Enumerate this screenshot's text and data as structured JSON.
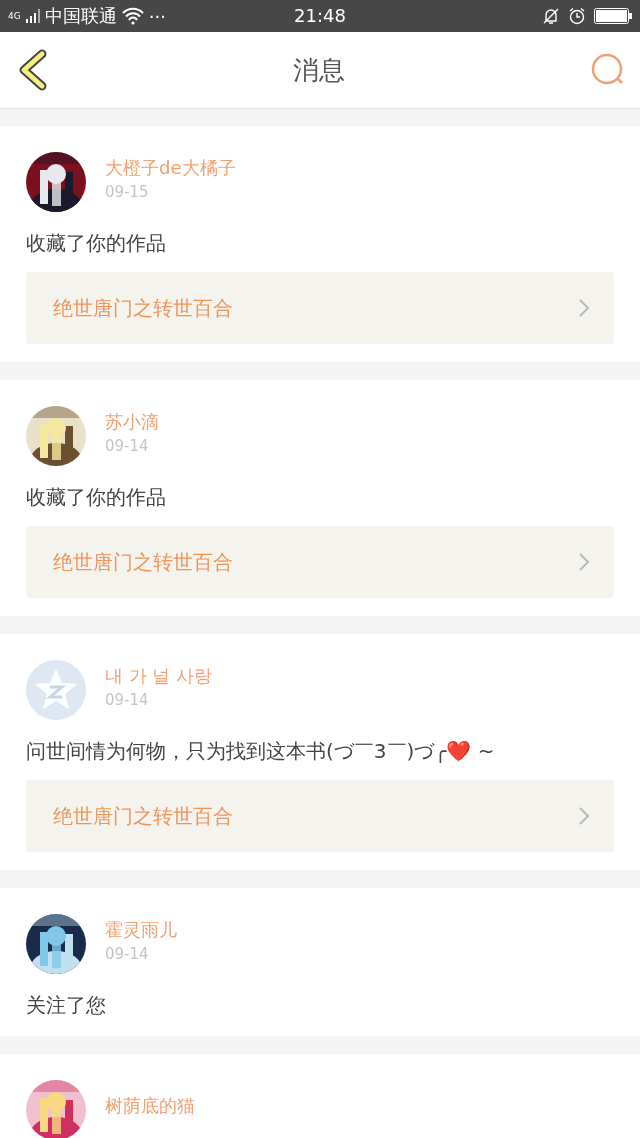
{
  "status_bar": {
    "network": "4G",
    "carrier": "中国联通",
    "more": "···",
    "time": "21:48"
  },
  "header": {
    "title": "消息"
  },
  "messages": [
    {
      "name": "大橙子de大橘子",
      "date": "09-15",
      "text": "收藏了你的作品",
      "work": "绝世唐门之转世百合"
    },
    {
      "name": "苏小滴",
      "date": "09-14",
      "text": "收藏了你的作品",
      "work": "绝世唐门之转世百合"
    },
    {
      "avatar": {
        "kind": "default"
      },
      "name": "내 가 널 사랑",
      "date": "09-14",
      "text": "问世间情为何物，只为找到这本书(づ￣3￣)づ╭❤️ ~",
      "work": "绝世唐门之转世百合"
    },
    {
      "name": "霍灵雨儿",
      "date": "09-14",
      "text": "关注了您"
    },
    {
      "name": "树荫底的猫"
    }
  ]
}
